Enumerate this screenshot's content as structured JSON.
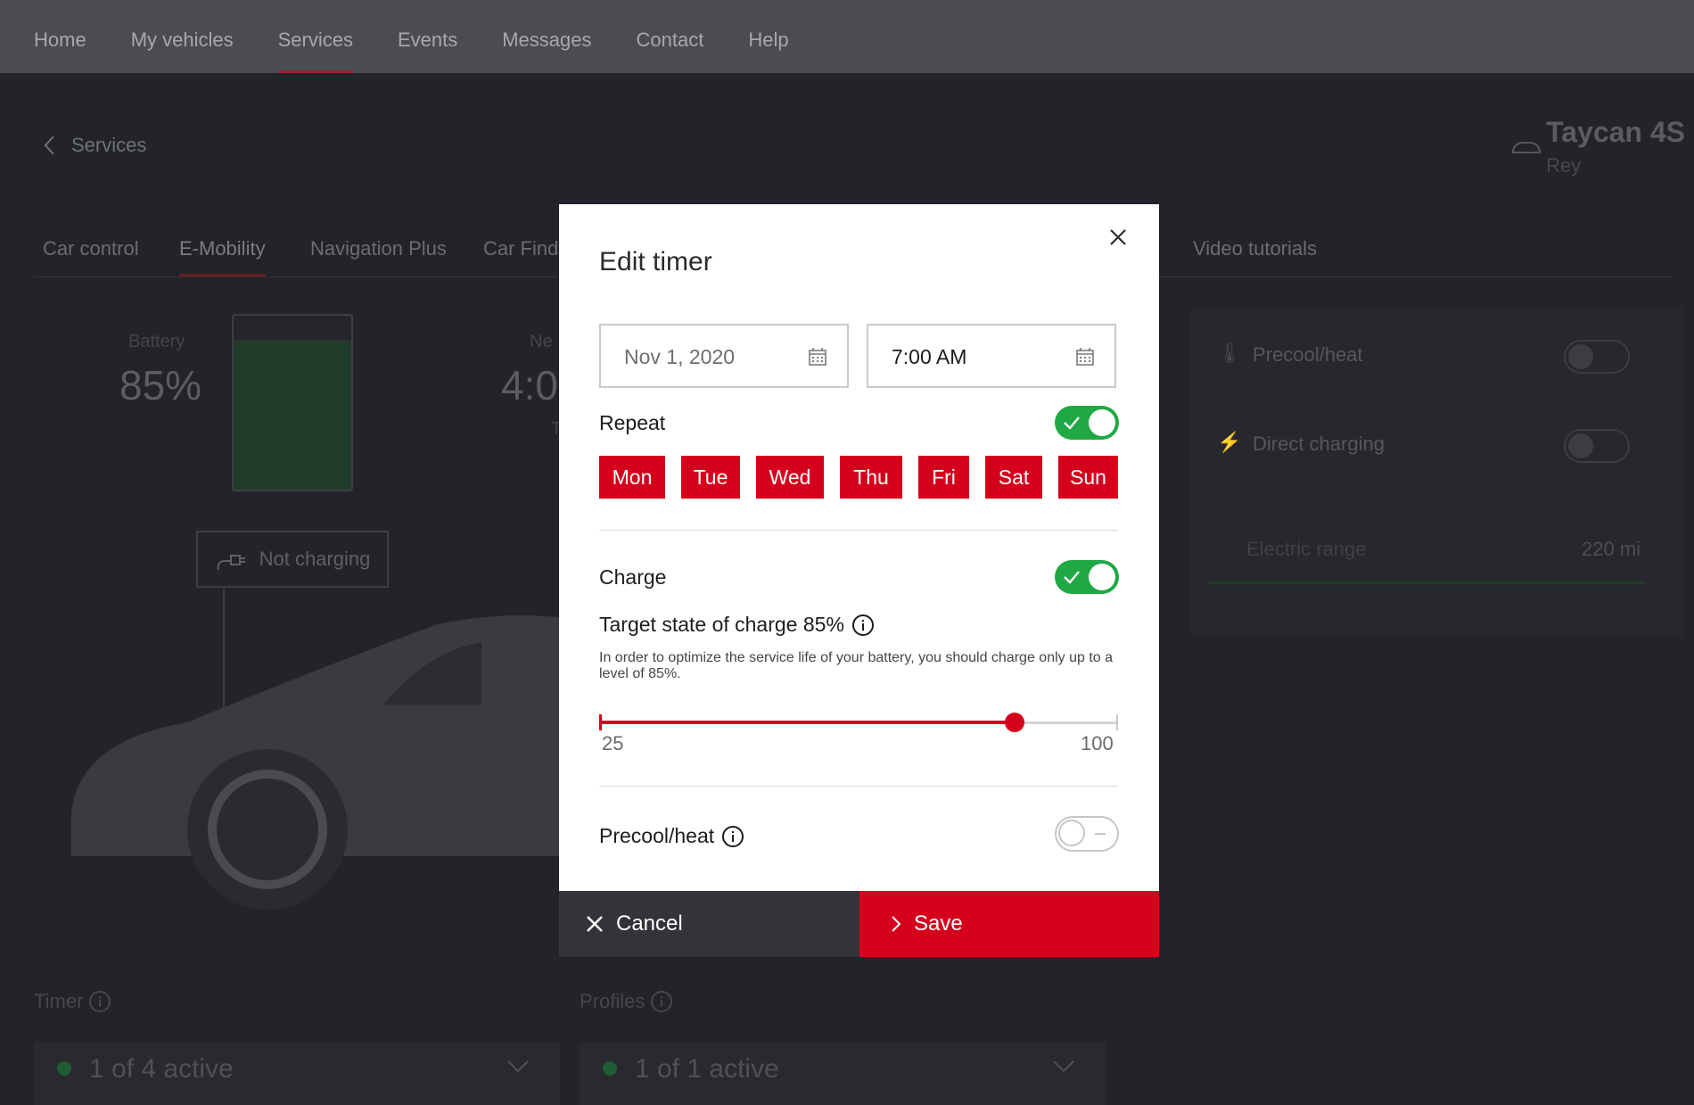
{
  "topnav": {
    "items": [
      {
        "label": "Home",
        "active": false
      },
      {
        "label": "My vehicles",
        "active": false
      },
      {
        "label": "Services",
        "active": true
      },
      {
        "label": "Events",
        "active": false
      },
      {
        "label": "Messages",
        "active": false
      },
      {
        "label": "Contact",
        "active": false
      },
      {
        "label": "Help",
        "active": false
      }
    ]
  },
  "breadcrumb": {
    "back_label": "Services"
  },
  "vehicle": {
    "name": "Taycan 4S",
    "nickname": "Rey",
    "icon": "car-icon"
  },
  "subtabs": [
    {
      "label": "Car control"
    },
    {
      "label": "E-Mobility",
      "active": true
    },
    {
      "label": "Navigation Plus"
    },
    {
      "label": "Car Finde"
    },
    {
      "label": "Video tutorials"
    }
  ],
  "emobility": {
    "battery_label": "Battery",
    "battery_pct": "85%",
    "battery_level": 0.85,
    "next_label": "Ne",
    "next_time": "4:0",
    "next_sub": "T",
    "status": "Not charging",
    "status_icon": "plug-icon"
  },
  "right_panel": {
    "rows": [
      {
        "label": "Precool/heat",
        "icon": "thermometer-icon",
        "on": false
      },
      {
        "label": "Direct charging",
        "icon": "lightning-icon",
        "on": false
      }
    ],
    "range_label": "Electric range",
    "range_value": "220 mi"
  },
  "sections": {
    "timer": {
      "title": "Timer",
      "summary": "1 of 4 active"
    },
    "profiles": {
      "title": "Profiles",
      "summary": "1 of 1 active"
    }
  },
  "modal": {
    "title": "Edit timer",
    "date_value": "Nov 1, 2020",
    "time_value": "7:00 AM",
    "repeat_label": "Repeat",
    "repeat_on": true,
    "days": [
      "Mon",
      "Tue",
      "Wed",
      "Thu",
      "Fri",
      "Sat",
      "Sun"
    ],
    "charge_label": "Charge",
    "charge_on": true,
    "target_label": "Target state of charge 85%",
    "hint": "In order to optimize the service life of your battery, you should charge only up to a level of 85%.",
    "slider": {
      "min": "25",
      "max": "100",
      "value": 85
    },
    "precool_label": "Precool/heat",
    "precool_on": false,
    "cancel_label": "Cancel",
    "save_label": "Save"
  },
  "colors": {
    "accent": "#d5001c",
    "toggle_on": "#1fa843",
    "cancel_bg": "#323438"
  }
}
